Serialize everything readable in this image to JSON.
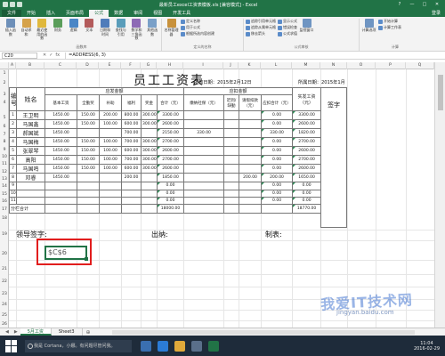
{
  "window": {
    "title": "最新员工excel工资表模板.xls [兼容模式] - Excel",
    "controls": [
      "?",
      "—",
      "□",
      "✕"
    ]
  },
  "ribbon_tabs": [
    "文件",
    "开始",
    "插入",
    "页面布局",
    "公式",
    "数据",
    "审阅",
    "视图",
    "开发工具"
  ],
  "active_tab": "公式",
  "user": "登录",
  "ribbon_groups": [
    {
      "label": "函数库",
      "buttons": [
        "插入函数",
        "自动求和",
        "最近使用的函数",
        "财务",
        "逻辑",
        "文本",
        "日期和时间",
        "查找与引用",
        "数学和三角函数",
        "其他函数"
      ]
    },
    {
      "label": "定义的名称",
      "buttons": [
        "名称管理器"
      ],
      "small": [
        "定义名称",
        "用于公式",
        "根据所选内容创建"
      ]
    },
    {
      "label": "公式审核",
      "small": [
        "追踪引用单元格",
        "追踪从属单元格",
        "移去箭头",
        "显示公式",
        "错误检查",
        "公式求值"
      ],
      "buttons": [
        "监视窗口"
      ]
    },
    {
      "label": "计算",
      "buttons": [
        "计算选项"
      ],
      "small": [
        "开始计算",
        "计算工作表"
      ]
    }
  ],
  "formula_bar": {
    "name_box": "C20",
    "cancel": "✕",
    "enter": "✓",
    "fx": "fx",
    "formula": "=ADDRESS(6, 3)"
  },
  "columns": [
    "A",
    "B",
    "C",
    "D",
    "E",
    "F",
    "G",
    "H",
    "I",
    "J",
    "K",
    "L",
    "M",
    "N",
    "O",
    "P",
    "Q"
  ],
  "rows": [
    "1",
    "2",
    "3",
    "4",
    "5",
    "6",
    "7",
    "8",
    "9",
    "10",
    "11",
    "12",
    "13",
    "14",
    "15",
    "16",
    "17",
    "18",
    "19",
    "20",
    "21",
    "22",
    "23",
    "24",
    "25",
    "26"
  ],
  "sheet": {
    "title": "员工工资表",
    "issue_date": "发放日期：2015年2月12日",
    "period": "所属日期：2015年1月",
    "headers": {
      "num": "编号",
      "name": "姓名",
      "payable": "应发金额",
      "deduction": "应扣金额",
      "actual": "实发工资（元）",
      "sign": "签字",
      "base": "基本工资",
      "allowance": "全勤奖",
      "subsidy": "补助",
      "welfare": "福利",
      "bonus": "奖金",
      "total": "合计（元）",
      "social": "缴纳社保（元）",
      "absence": "迟到/缺勤",
      "leave": "请假扣款（元）",
      "ded_total": "应扣合计（元）"
    },
    "data_rows": [
      {
        "no": "1",
        "name": "王卫明",
        "base": "1450.00",
        "allow": "150.00",
        "sub": "200.00",
        "wel": "800.00",
        "bonus": "300.00",
        "total": "3300.00",
        "social": "",
        "absence": "",
        "leave": "",
        "ded": "0.00",
        "actual": "3300.00"
      },
      {
        "no": "2",
        "name": "马国鑫",
        "base": "1450.00",
        "allow": "150.00",
        "sub": "100.00",
        "wel": "600.00",
        "bonus": "300.00",
        "total": "2600.00",
        "social": "",
        "absence": "",
        "leave": "",
        "ded": "0.00",
        "actual": "2600.00"
      },
      {
        "no": "3",
        "name": "郝国斌",
        "base": "1450.00",
        "allow": "",
        "sub": "",
        "wel": "700.00",
        "bonus": "",
        "total": "2150.00",
        "social": "330.00",
        "absence": "",
        "leave": "",
        "ded": "330.00",
        "actual": "1820.00"
      },
      {
        "no": "4",
        "name": "马国梅",
        "base": "1450.00",
        "allow": "150.00",
        "sub": "100.00",
        "wel": "700.00",
        "bonus": "300.00",
        "total": "2700.00",
        "social": "",
        "absence": "",
        "leave": "",
        "ded": "0.00",
        "actual": "2700.00"
      },
      {
        "no": "5",
        "name": "张翠琴",
        "base": "1450.00",
        "allow": "150.00",
        "sub": "100.00",
        "wel": "600.00",
        "bonus": "300.00",
        "total": "2600.00",
        "social": "",
        "absence": "",
        "leave": "",
        "ded": "0.00",
        "actual": "2600.00"
      },
      {
        "no": "6",
        "name": "高阳",
        "base": "1450.00",
        "allow": "150.00",
        "sub": "100.00",
        "wel": "700.00",
        "bonus": "300.00",
        "total": "2700.00",
        "social": "",
        "absence": "",
        "leave": "",
        "ded": "0.00",
        "actual": "2700.00"
      },
      {
        "no": "7",
        "name": "马国鸣",
        "base": "1450.00",
        "allow": "150.00",
        "sub": "100.00",
        "wel": "600.00",
        "bonus": "300.00",
        "total": "2600.00",
        "social": "",
        "absence": "",
        "leave": "",
        "ded": "0.00",
        "actual": "2600.00"
      },
      {
        "no": "8",
        "name": "邓睿",
        "base": "1450.00",
        "allow": "",
        "sub": "",
        "wel": "200.00",
        "bonus": "",
        "total": "1850.00",
        "social": "",
        "absence": "",
        "leave": "200.00",
        "ded": "200.00",
        "actual": "1650.00"
      },
      {
        "no": "9",
        "name": "",
        "base": "",
        "allow": "",
        "sub": "",
        "wel": "",
        "bonus": "",
        "total": "0.00",
        "social": "",
        "absence": "",
        "leave": "",
        "ded": "0.00",
        "actual": "0.00"
      },
      {
        "no": "10",
        "name": "",
        "base": "",
        "allow": "",
        "sub": "",
        "wel": "",
        "bonus": "",
        "total": "0.00",
        "social": "",
        "absence": "",
        "leave": "",
        "ded": "0.00",
        "actual": "0.00"
      },
      {
        "no": "11",
        "name": "",
        "base": "",
        "allow": "",
        "sub": "",
        "wel": "",
        "bonus": "",
        "total": "0.00",
        "social": "",
        "absence": "",
        "leave": "",
        "ded": "0.00",
        "actual": "0.00"
      }
    ],
    "subtotal_label": "分栏合计",
    "subtotal_total": "18000.00",
    "subtotal_actual": "18770.00",
    "sign_leader": "领导签字:",
    "sign_cashier": "出纳:",
    "sign_maker": "制表:",
    "selected_cell_value": "$C$6"
  },
  "sheet_tabs": [
    "5月工资",
    "Sheet3"
  ],
  "active_sheet": "5月工资",
  "add_sheet": "⊕",
  "taskbar": {
    "search_placeholder": "我是 Cortana，小娜。有问题尽管问我。",
    "time": "11:04",
    "date": "2016-02-29"
  },
  "watermark": {
    "main": "我爱IT技术网",
    "sub": "jingyan.baidu.com"
  },
  "colors": {
    "excel_green": "#217346",
    "highlight_red": "#e11d1d",
    "taskbar": "#1e2b3a"
  }
}
